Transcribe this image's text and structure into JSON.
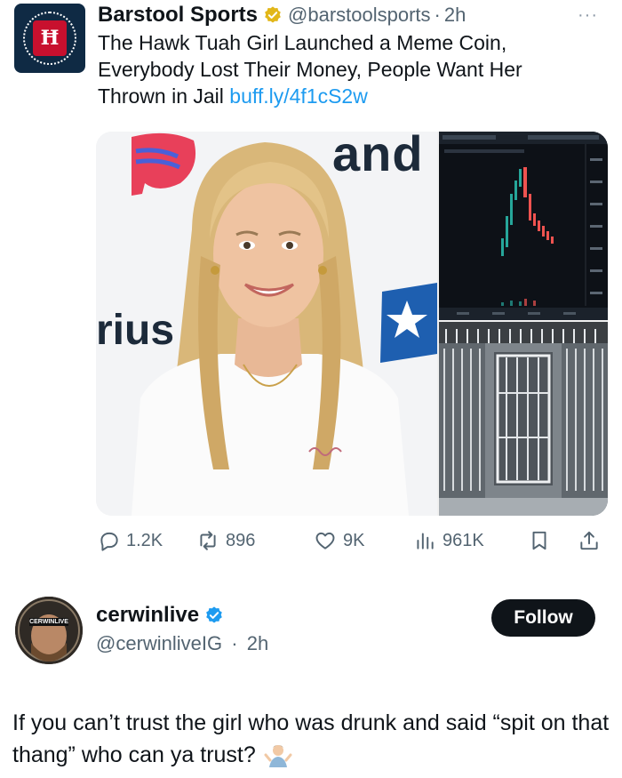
{
  "quoted_tweet": {
    "display_name": "Barstool Sports",
    "handle": "@barstoolsports",
    "separator": "·",
    "time": "2h",
    "more_glyph": "···",
    "avatar_icon": "barstool-logo",
    "verified_badge": "gold-check",
    "text": "The Hawk Tuah Girl Launched a Meme Coin, Everybody Lost Their Money, People Want Her Thrown in Jail",
    "link": "buff.ly/4f1cS2w",
    "media": {
      "left_photo": "woman-smiling-at-press-event",
      "backdrop_text_top": "and",
      "backdrop_text_side": "rius",
      "top_right": "crypto-candlestick-chart",
      "bottom_right": "jail-cell"
    },
    "metrics": {
      "replies": "1.2K",
      "reposts": "896",
      "likes": "9K",
      "views": "961K"
    }
  },
  "reply_tweet": {
    "display_name": "cerwinlive",
    "handle": "@cerwinliveIG",
    "separator": "·",
    "time": "2h",
    "avatar_label": "CERWINLIVE",
    "verified_badge": "blue-check",
    "follow_label": "Follow",
    "text": "If you can’t trust the girl who was drunk and said “spit on that thang” who can ya trust?",
    "emoji": "man-shrugging"
  },
  "colors": {
    "link": "#1d9bf0",
    "muted": "#536471",
    "gold_badge": "#e2b719",
    "blue_badge": "#1d9bf0",
    "chart_up": "#26a69a",
    "chart_down": "#ef5350"
  }
}
